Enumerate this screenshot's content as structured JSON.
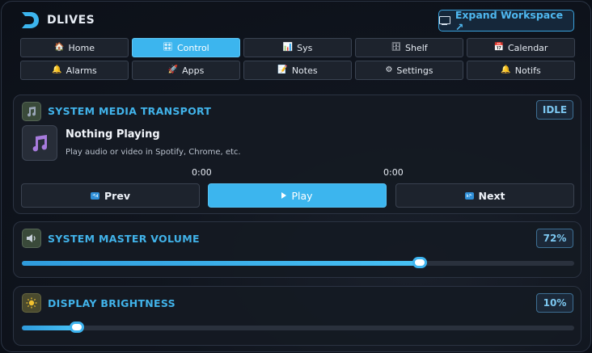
{
  "app": {
    "title": "DLIVES",
    "expand_label": "Expand Workspace ↗"
  },
  "nav": [
    {
      "label": "Home",
      "icon": "🏠",
      "active": false
    },
    {
      "label": "Control",
      "icon": "🎛",
      "active": true
    },
    {
      "label": "Sys",
      "icon": "📊",
      "active": false
    },
    {
      "label": "Shelf",
      "icon": "🗄",
      "active": false
    },
    {
      "label": "Calendar",
      "icon": "📅",
      "active": false
    },
    {
      "label": "Alarms",
      "icon": "🔔",
      "active": false
    },
    {
      "label": "Apps",
      "icon": "🚀",
      "active": false
    },
    {
      "label": "Notes",
      "icon": "📝",
      "active": false
    },
    {
      "label": "Settings",
      "icon": "⚙",
      "active": false
    },
    {
      "label": "Notifs",
      "icon": "🔔",
      "active": false
    }
  ],
  "media": {
    "title": "SYSTEM MEDIA TRANSPORT",
    "status": "IDLE",
    "track_title": "Nothing Playing",
    "track_subtitle": "Play audio or video in Spotify, Chrome, etc.",
    "elapsed": "0:00",
    "duration": "0:00",
    "prev_label": "Prev",
    "play_label": "Play",
    "next_label": "Next"
  },
  "volume": {
    "title": "SYSTEM MASTER VOLUME",
    "value_label": "72%",
    "level": 72
  },
  "brightness": {
    "title": "DISPLAY BRIGHTNESS",
    "value_label": "10%",
    "level": 10
  },
  "colors": {
    "accent": "#3cb5ee",
    "title_blue": "#41b3ea",
    "panel_bg": "#151a23"
  }
}
